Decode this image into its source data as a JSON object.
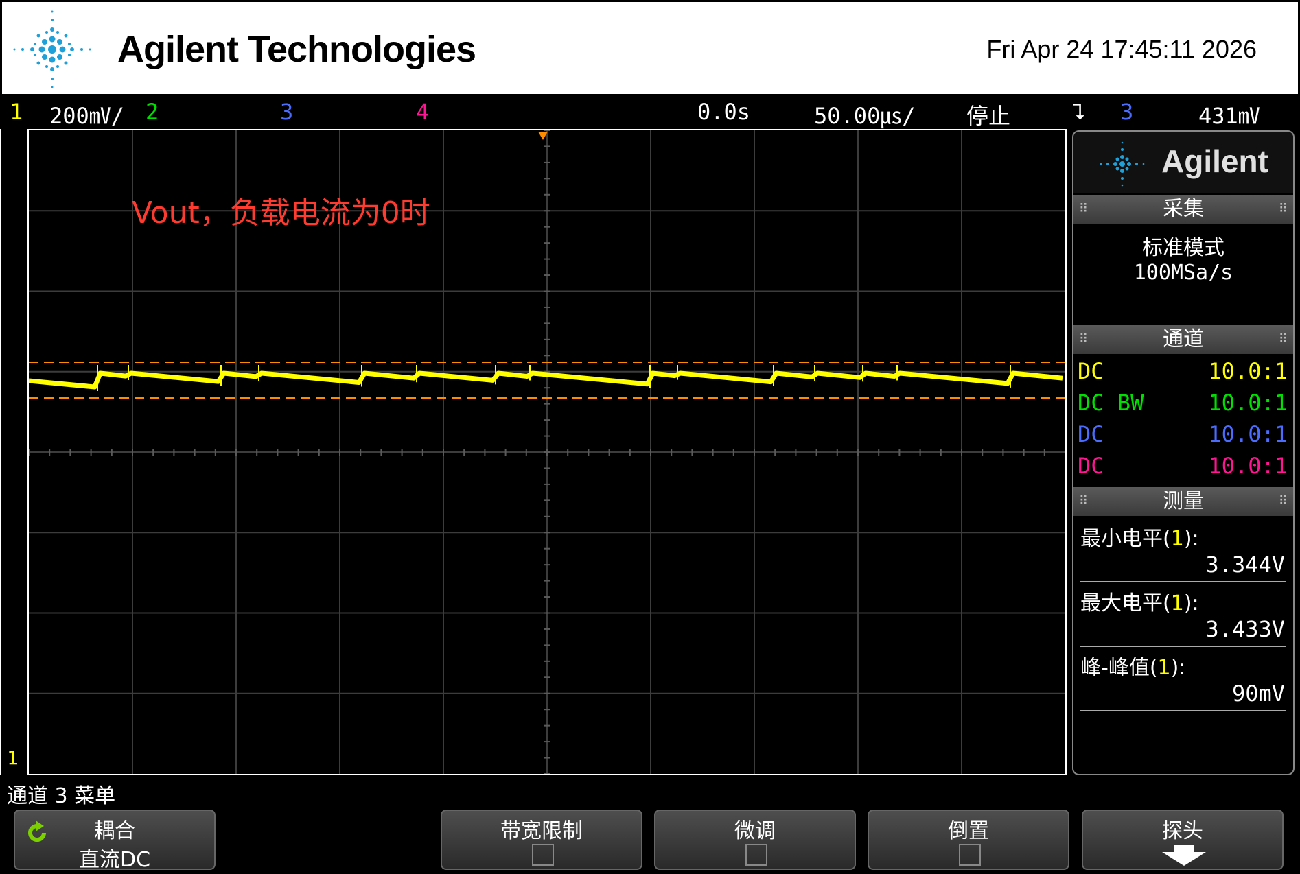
{
  "header": {
    "brand": "Agilent Technologies",
    "datetime": "Fri Apr 24 17:45:11 2026"
  },
  "statusbar": {
    "ch1_num": "1",
    "ch1_scale": "200㎷/",
    "ch2_num": "2",
    "ch3_num": "3",
    "ch4_num": "4",
    "delay": "0.0s",
    "timebase": "50.00㎲/",
    "run_state": "停止",
    "trigger_icon": "trigger-falling-edge-icon",
    "trigger_source": "3",
    "trigger_level": "431㎷",
    "colors": {
      "ch1": "#ffff00",
      "ch2": "#00e000",
      "ch3": "#4a6cff",
      "ch4": "#ff1493"
    }
  },
  "screen": {
    "annotation": "Vout，负载电流为0时",
    "ground_marker": "1"
  },
  "panel": {
    "logo": "Agilent",
    "acquire": {
      "title": "采集",
      "mode": "标准模式",
      "rate": "100MSa/s"
    },
    "channels": {
      "title": "通道",
      "rows": [
        {
          "coupling": "DC",
          "probe": "10.0:1",
          "color": "#ffff00"
        },
        {
          "coupling": "DC BW",
          "probe": "10.0:1",
          "color": "#00e000"
        },
        {
          "coupling": "DC",
          "probe": "10.0:1",
          "color": "#4a6cff"
        },
        {
          "coupling": "DC",
          "probe": "10.0:1",
          "color": "#ff1493"
        }
      ]
    },
    "measure": {
      "title": "测量",
      "items": [
        {
          "label": "最小电平",
          "ch": "1",
          "value": "3.344V"
        },
        {
          "label": "最大电平",
          "ch": "1",
          "value": "3.433V"
        },
        {
          "label": "峰-峰值",
          "ch": "1",
          "value": "90mV"
        }
      ]
    }
  },
  "menu": {
    "title": "通道 3 菜单",
    "softkeys": [
      {
        "label": "耦合",
        "value": "直流DC"
      },
      {
        "label": "带宽限制"
      },
      {
        "label": "微调"
      },
      {
        "label": "倒置"
      },
      {
        "label": "探头"
      }
    ]
  }
}
